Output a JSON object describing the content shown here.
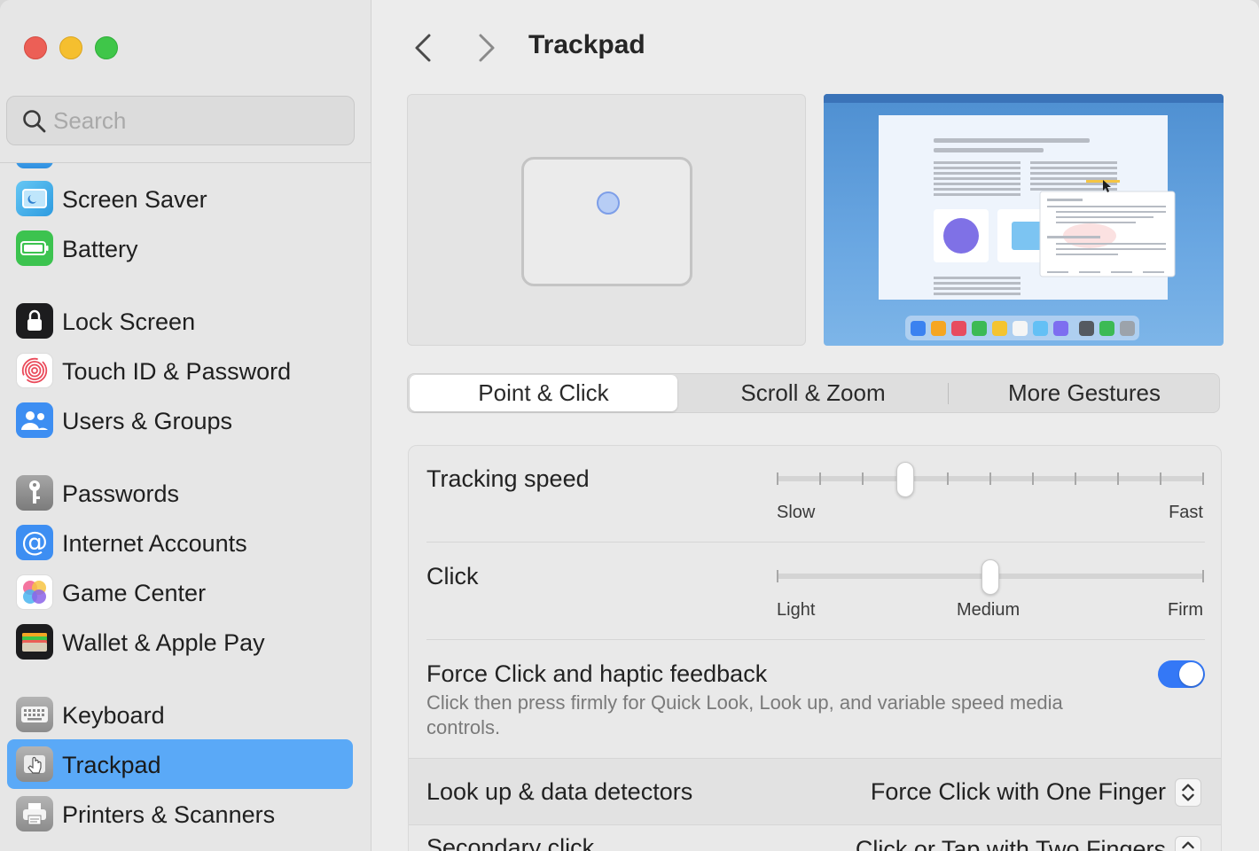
{
  "window": {
    "title": "Trackpad"
  },
  "search": {
    "placeholder": "Search"
  },
  "sidebar": {
    "items": [
      {
        "label": "Screen Saver",
        "icon": "screen-saver-icon"
      },
      {
        "label": "Battery",
        "icon": "battery-icon"
      },
      {
        "label": "Lock Screen",
        "icon": "lock-icon"
      },
      {
        "label": "Touch ID & Password",
        "icon": "fingerprint-icon"
      },
      {
        "label": "Users & Groups",
        "icon": "users-icon"
      },
      {
        "label": "Passwords",
        "icon": "key-icon"
      },
      {
        "label": "Internet Accounts",
        "icon": "at-sign-icon"
      },
      {
        "label": "Game Center",
        "icon": "game-center-icon"
      },
      {
        "label": "Wallet & Apple Pay",
        "icon": "wallet-icon"
      },
      {
        "label": "Keyboard",
        "icon": "keyboard-icon"
      },
      {
        "label": "Trackpad",
        "icon": "trackpad-icon",
        "selected": true
      },
      {
        "label": "Printers & Scanners",
        "icon": "printer-icon"
      }
    ]
  },
  "header": {
    "title": "Trackpad"
  },
  "tabs": [
    {
      "label": "Point & Click",
      "selected": true
    },
    {
      "label": "Scroll & Zoom"
    },
    {
      "label": "More Gestures"
    }
  ],
  "settings": {
    "tracking_speed": {
      "label": "Tracking speed",
      "min_label": "Slow",
      "max_label": "Fast",
      "value_step": 3,
      "steps": 10
    },
    "click": {
      "label": "Click",
      "min_label": "Light",
      "mid_label": "Medium",
      "max_label": "Firm",
      "value_step": 1,
      "steps": 2
    },
    "force_click": {
      "label": "Force Click and haptic feedback",
      "description": "Click then press firmly for Quick Look, Look up, and variable speed media controls.",
      "enabled": true
    },
    "lookup": {
      "label": "Look up & data detectors",
      "value": "Force Click with One Finger"
    },
    "secondary_click": {
      "label": "Secondary click",
      "value": "Click or Tap with Two Fingers"
    }
  },
  "colors": {
    "accent": "#3478f6",
    "selection": "#5aa9f7"
  }
}
